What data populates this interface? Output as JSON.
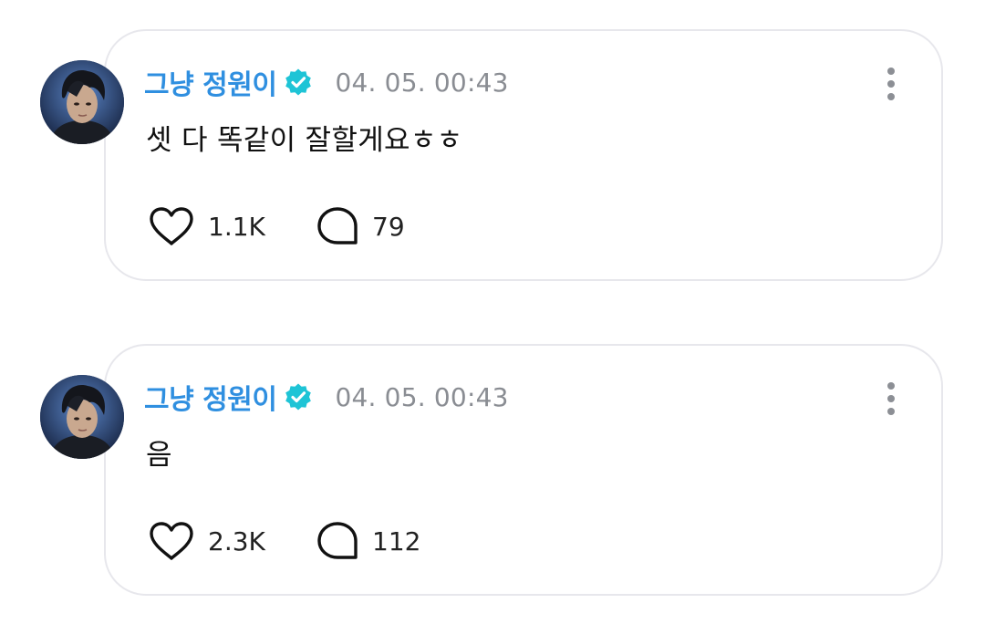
{
  "theme": {
    "author_color": "#2f8fe0",
    "verified_color": "#1ec4d6",
    "timestamp_color": "#8a8d93",
    "border_color": "#e7e7ec"
  },
  "posts": [
    {
      "author": "그냥 정원이",
      "verified": true,
      "timestamp": "04. 05. 00:43",
      "content": "셋 다 똑같이 잘할게요ㅎㅎ",
      "likes": "1.1K",
      "comments": "79",
      "icons": {
        "like": "heart-icon",
        "comment": "speech-bubble-icon",
        "more": "vertical-dots-icon"
      }
    },
    {
      "author": "그냥 정원이",
      "verified": true,
      "timestamp": "04. 05. 00:43",
      "content": "음",
      "likes": "2.3K",
      "comments": "112",
      "icons": {
        "like": "heart-icon",
        "comment": "speech-bubble-icon",
        "more": "vertical-dots-icon"
      }
    }
  ]
}
